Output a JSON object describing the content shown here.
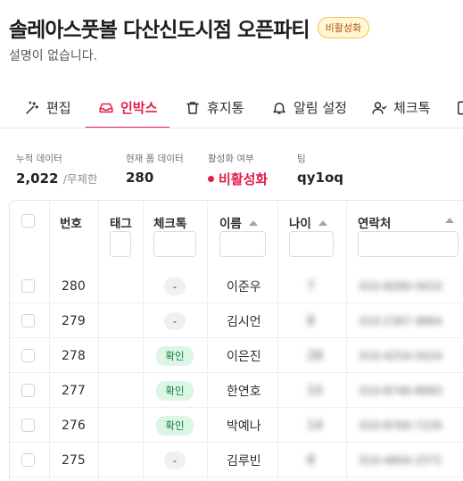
{
  "header": {
    "title": "솔레아스풋볼 다산신도시점 오픈파티",
    "status_badge": "비활성화",
    "description": "설명이 없습니다."
  },
  "tabs": [
    {
      "label": "편집",
      "icon": "magic-wand-icon"
    },
    {
      "label": "인박스",
      "icon": "inbox-icon",
      "active": true
    },
    {
      "label": "휴지통",
      "icon": "trash-icon"
    },
    {
      "label": "알림 설정",
      "icon": "bell-icon"
    },
    {
      "label": "체크톡",
      "icon": "user-check-icon"
    }
  ],
  "stats": {
    "cumulative": {
      "label": "누적 데이터",
      "value": "2,022",
      "sub": "/무제한"
    },
    "current": {
      "label": "현재 폼 데이터",
      "value": "280"
    },
    "active": {
      "label": "활성화 여부",
      "value": "비활성화"
    },
    "team": {
      "label": "팀",
      "value": "qy1oq"
    }
  },
  "table": {
    "columns": {
      "no": "번호",
      "tag": "태그",
      "checktalk": "체크톡",
      "name": "이름",
      "age": "나이",
      "contact": "연락처"
    },
    "rows": [
      {
        "no": "280",
        "checktalk": "-",
        "checked": false,
        "name": "이준우",
        "age": "7",
        "contact": "010-8280-5633"
      },
      {
        "no": "279",
        "checktalk": "-",
        "checked": false,
        "name": "김시언",
        "age": "8",
        "contact": "010-2367-4864"
      },
      {
        "no": "278",
        "checktalk": "확인",
        "checked": true,
        "name": "이은진",
        "age": "28",
        "contact": "010-4254-5024"
      },
      {
        "no": "277",
        "checktalk": "확인",
        "checked": true,
        "name": "한연호",
        "age": "10",
        "contact": "010-8746-8683"
      },
      {
        "no": "276",
        "checktalk": "확인",
        "checked": true,
        "name": "박예나",
        "age": "14",
        "contact": "010-8760-7226"
      },
      {
        "no": "275",
        "checktalk": "-",
        "checked": false,
        "name": "김루빈",
        "age": "8",
        "contact": "010-4804-2571"
      }
    ]
  },
  "colors": {
    "accent": "#e11d48",
    "badge_bg": "#fff7d6",
    "ok_bg": "#dcf5e6"
  }
}
